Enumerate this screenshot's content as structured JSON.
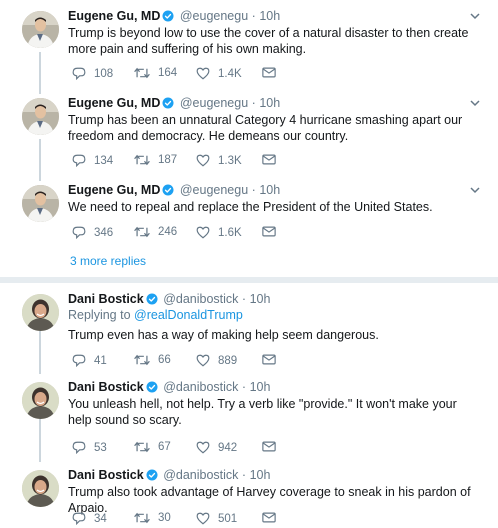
{
  "tweets_top": [
    {
      "name": "Eugene Gu, MD",
      "handle": "@eugenegu",
      "time": "10h",
      "text": "Trump is beyond low to use the cover of a natural disaster to then create more pain and suffering of his own making.",
      "replies": "108",
      "retweets": "164",
      "likes": "1.4K"
    },
    {
      "name": "Eugene Gu, MD",
      "handle": "@eugenegu",
      "time": "10h",
      "text": "Trump has been an unnatural Category 4 hurricane smashing apart our freedom and democracy. He demeans our country.",
      "replies": "134",
      "retweets": "187",
      "likes": "1.3K"
    },
    {
      "name": "Eugene Gu, MD",
      "handle": "@eugenegu",
      "time": "10h",
      "text": "We need to repeal and replace the President of the United States.",
      "replies": "346",
      "retweets": "246",
      "likes": "1.6K"
    }
  ],
  "more_replies": "3 more replies",
  "tweets_bottom": [
    {
      "name": "Dani Bostick",
      "handle": "@danibostick",
      "time": "10h",
      "replying_to_prefix": "Replying to ",
      "replying_to": "@realDonaldTrump",
      "text": "Trump even has a way of making help seem dangerous.",
      "replies": "41",
      "retweets": "66",
      "likes": "889"
    },
    {
      "name": "Dani Bostick",
      "handle": "@danibostick",
      "time": "10h",
      "text": "You unleash hell, not help. Try a verb like \"provide.\" It won't make your help sound so scary.",
      "replies": "53",
      "retweets": "67",
      "likes": "942"
    },
    {
      "name": "Dani Bostick",
      "handle": "@danibostick",
      "time": "10h",
      "text": "Trump also took advantage of Harvey coverage to sneak in his pardon of Arpaio.",
      "replies": "34",
      "retweets": "30",
      "likes": "501"
    }
  ],
  "separator": "·",
  "colors": {
    "link": "#1b95e0",
    "muted": "#657786",
    "text": "#14171a",
    "verified": "#1da1f2"
  }
}
